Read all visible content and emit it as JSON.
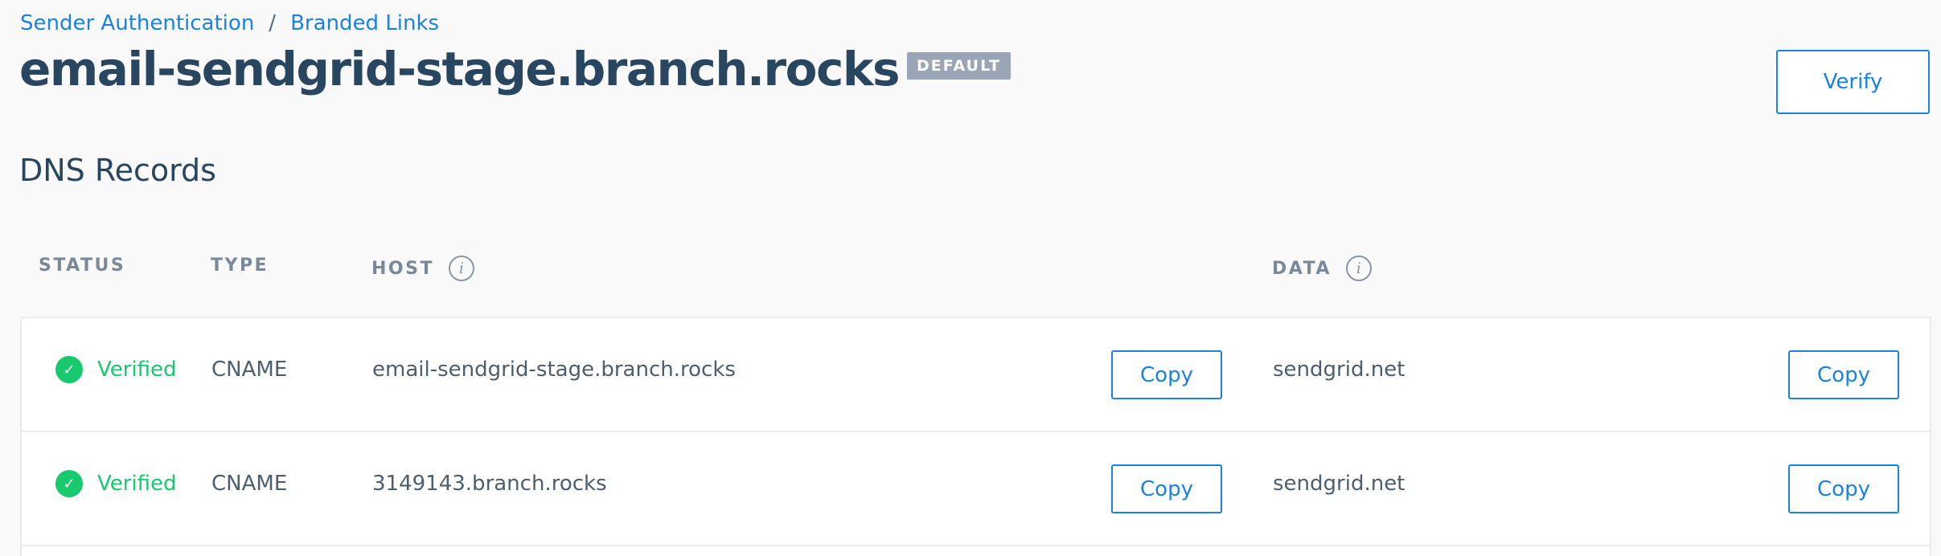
{
  "breadcrumb": {
    "items": [
      "Sender Authentication",
      "Branded Links"
    ],
    "separator": "/"
  },
  "header": {
    "title": "email-sendgrid-stage.branch.rocks",
    "badge": "DEFAULT",
    "verify_label": "Verify"
  },
  "section": {
    "title": "DNS Records"
  },
  "table": {
    "columns": {
      "status": "STATUS",
      "type": "TYPE",
      "host": "HOST",
      "data": "DATA"
    },
    "info_glyph": "i",
    "check_glyph": "✓",
    "rows": [
      {
        "status": "Verified",
        "type": "CNAME",
        "host": "email-sendgrid-stage.branch.rocks",
        "host_copy_label": "Copy",
        "data": "sendgrid.net",
        "data_copy_label": "Copy"
      },
      {
        "status": "Verified",
        "type": "CNAME",
        "host": "3149143.branch.rocks",
        "host_copy_label": "Copy",
        "data": "sendgrid.net",
        "data_copy_label": "Copy"
      }
    ]
  },
  "colors": {
    "accent": "#1a82e2",
    "title": "#294661",
    "verified": "#18c96e",
    "badge_bg": "#9aa6b5",
    "background": "#f9f9f9"
  },
  "icons": {
    "status": "check-circle-icon",
    "column_info": "info-icon"
  }
}
